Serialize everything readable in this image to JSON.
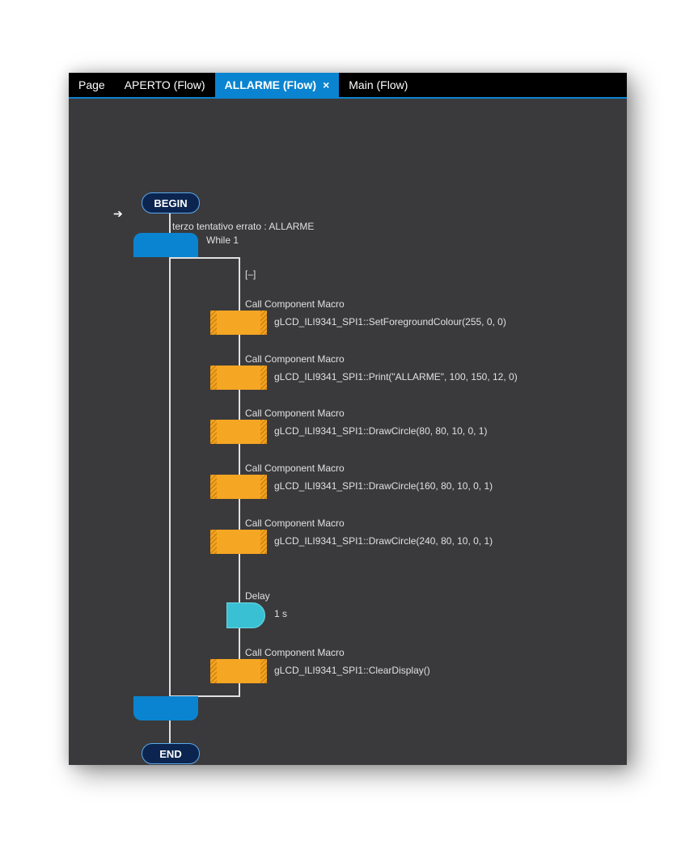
{
  "tabs": {
    "items": [
      {
        "label": "Page",
        "active": false,
        "closeable": false,
        "partial": true
      },
      {
        "label": "APERTO (Flow)",
        "active": false,
        "closeable": false
      },
      {
        "label": "ALLARME (Flow)",
        "active": true,
        "closeable": true
      },
      {
        "label": "Main (Flow)",
        "active": false,
        "closeable": false
      }
    ],
    "close_glyph": "×"
  },
  "flow": {
    "begin": "BEGIN",
    "end": "END",
    "comment": "terzo tentativo errato : ALLARME",
    "while_label": "While 1",
    "collapse": "[–]",
    "blocks": [
      {
        "type": "component",
        "title": "Call Component Macro",
        "call": "gLCD_ILI9341_SPI1::SetForegroundColour(255, 0, 0)"
      },
      {
        "type": "component",
        "title": "Call Component Macro",
        "call": "gLCD_ILI9341_SPI1::Print(\"ALLARME\", 100, 150, 12, 0)"
      },
      {
        "type": "component",
        "title": "Call Component Macro",
        "call": "gLCD_ILI9341_SPI1::DrawCircle(80, 80, 10, 0, 1)"
      },
      {
        "type": "component",
        "title": "Call Component Macro",
        "call": "gLCD_ILI9341_SPI1::DrawCircle(160, 80, 10, 0, 1)"
      },
      {
        "type": "component",
        "title": "Call Component Macro",
        "call": "gLCD_ILI9341_SPI1::DrawCircle(240, 80, 10, 0, 1)"
      },
      {
        "type": "delay",
        "title": "Delay",
        "call": "1 s"
      },
      {
        "type": "component",
        "title": "Call Component Macro",
        "call": "gLCD_ILI9341_SPI1::ClearDisplay()"
      }
    ]
  }
}
